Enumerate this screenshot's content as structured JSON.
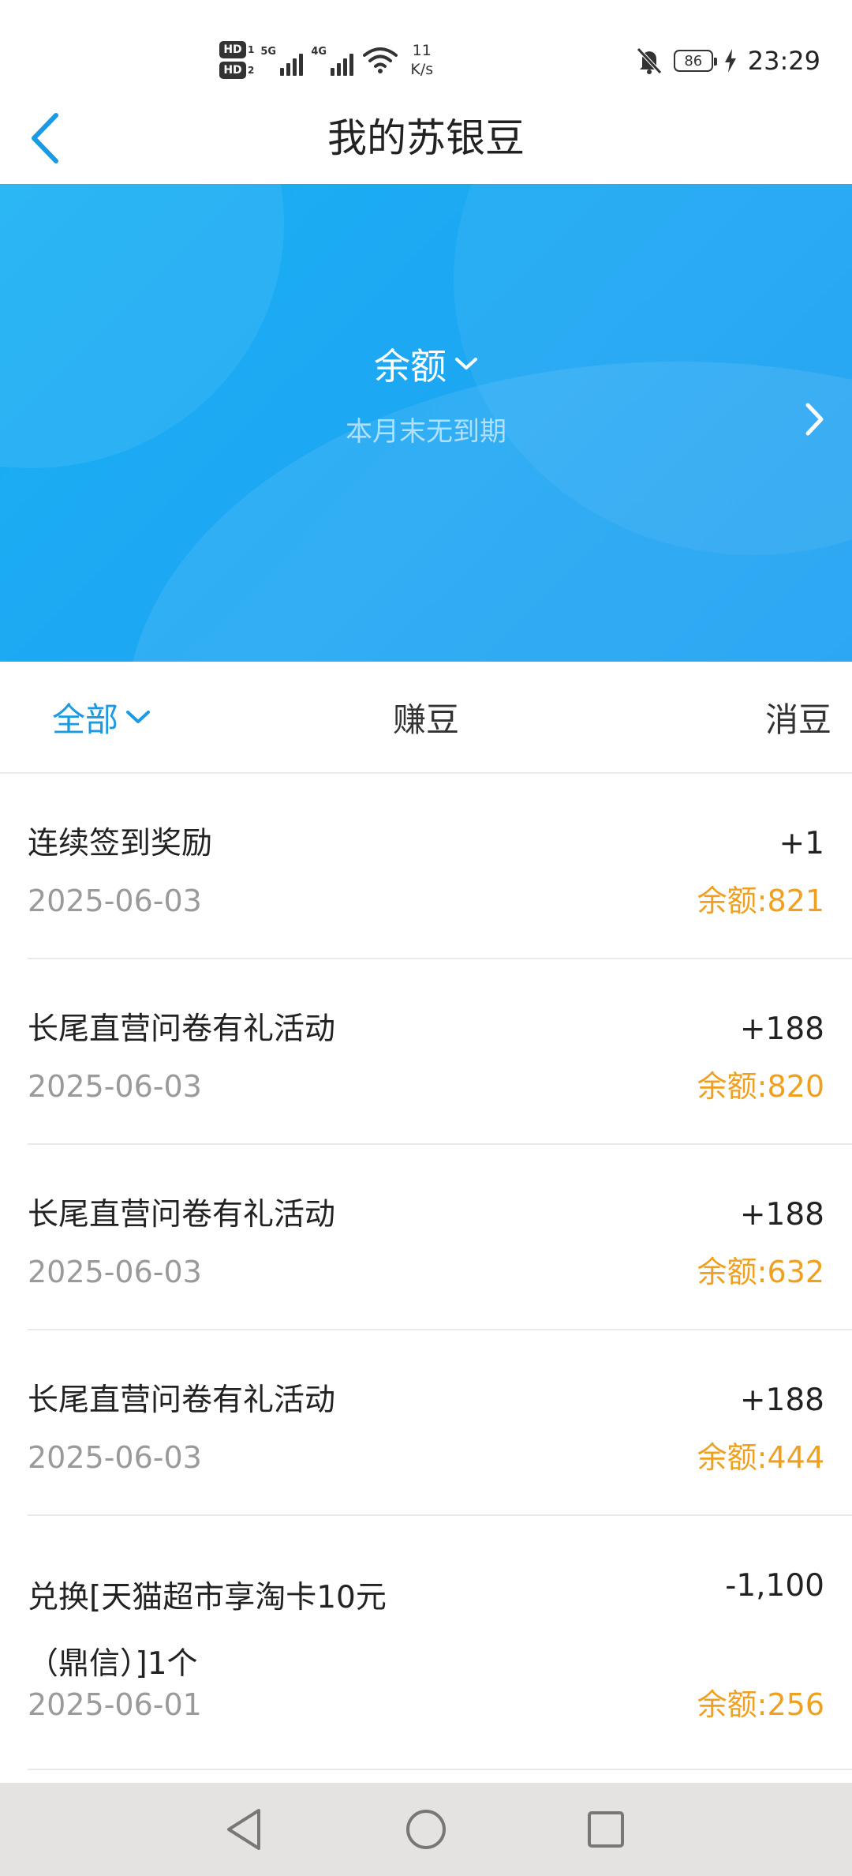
{
  "status_bar": {
    "hd1": "HD",
    "hd1_sub": "1",
    "hd2": "HD",
    "hd2_sub": "2",
    "sim1_gen": "5G",
    "sim2_gen": "4G",
    "speed_value": "11",
    "speed_unit": "K/s",
    "battery_level": "86",
    "time": "23:29",
    "icons": [
      "signal-icon",
      "wifi-icon",
      "bell-off-icon",
      "battery-icon",
      "charging-icon"
    ]
  },
  "header": {
    "title": "我的苏银豆",
    "back_icon": "back-chevron-icon"
  },
  "banner": {
    "balance_label": "余额",
    "expire_note": "本月末无到期",
    "colors": {
      "start": "#19b0f3",
      "end": "#1a9ff1"
    }
  },
  "tabs": {
    "all": "全部",
    "earn": "赚豆",
    "spend": "消豆",
    "active": "全部",
    "active_color": "#1b9ae4"
  },
  "transactions": [
    {
      "title": "连续签到奖励",
      "amount": "+1",
      "date": "2025-06-03",
      "balance": "余额:821"
    },
    {
      "title": "长尾直营问卷有礼活动",
      "amount": "+188",
      "date": "2025-06-03",
      "balance": "余额:820"
    },
    {
      "title": "长尾直营问卷有礼活动",
      "amount": "+188",
      "date": "2025-06-03",
      "balance": "余额:632"
    },
    {
      "title": "长尾直营问卷有礼活动",
      "amount": "+188",
      "date": "2025-06-03",
      "balance": "余额:444"
    },
    {
      "title": "兑换[天猫超市享淘卡10元（鼎信）]1个",
      "amount": "-1,100",
      "date": "2025-06-01",
      "balance": "余额:256"
    }
  ],
  "colors": {
    "balance_text": "#f0a020",
    "date_text": "#9a9a9a"
  },
  "nav_bar": {
    "icons": [
      "nav-back-icon",
      "nav-home-icon",
      "nav-recent-icon"
    ]
  }
}
